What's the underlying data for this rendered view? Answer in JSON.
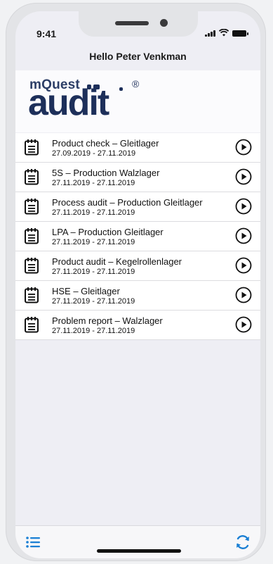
{
  "status_bar": {
    "time": "9:41"
  },
  "header": {
    "greeting": "Hello Peter Venkman"
  },
  "logo": {
    "brand_top": "mQuest",
    "brand_main": "audit",
    "reg_mark": "®"
  },
  "audits": [
    {
      "title": "Product check – Gleitlager",
      "dates": "27.09.2019 - 27.11.2019"
    },
    {
      "title": "5S – Production Walzlager",
      "dates": "27.11.2019 - 27.11.2019"
    },
    {
      "title": "Process audit – Production Gleitlager",
      "dates": "27.11.2019 - 27.11.2019"
    },
    {
      "title": "LPA – Production Gleitlager",
      "dates": "27.11.2019 - 27.11.2019"
    },
    {
      "title": "Product audit – Kegelrollenlager",
      "dates": "27.11.2019 - 27.11.2019"
    },
    {
      "title": "HSE – Gleitlager",
      "dates": "27.11.2019 - 27.11.2019"
    },
    {
      "title": "Problem report – Walzlager",
      "dates": "27.11.2019 - 27.11.2019"
    }
  ],
  "tab_bar": {
    "left_icon": "list-icon",
    "right_icon": "sync-icon"
  },
  "colors": {
    "accent": "#1a7fd4",
    "brand": "#1d2f5a"
  }
}
